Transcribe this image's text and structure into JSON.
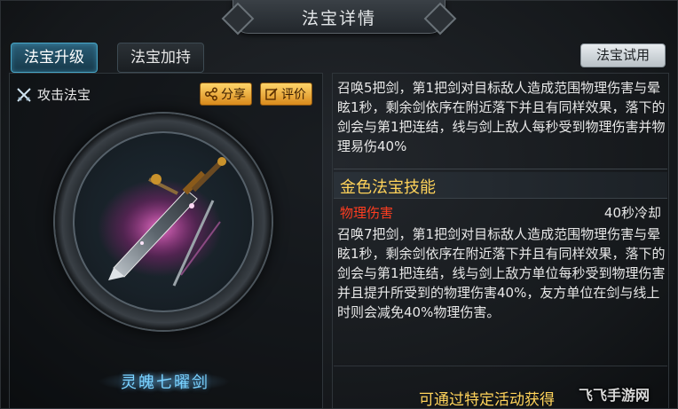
{
  "header": {
    "title": "法宝详情"
  },
  "tabs": [
    {
      "label": "法宝升级",
      "active": true
    },
    {
      "label": "法宝加持",
      "active": false
    }
  ],
  "try_button": "法宝试用",
  "artifact": {
    "type_label": "攻击法宝",
    "type_icon": "crossed-swords-icon",
    "share_label": "分享",
    "share_icon": "share-icon",
    "review_label": "评价",
    "review_icon": "edit-icon",
    "name": "灵魄七曜剑"
  },
  "description": "召唤5把剑，第1把剑对目标敌人造成范围物理伤害与晕眩1秒，剩余剑依序在附近落下并且有同样效果，落下的剑会与第1把连结，线与剑上敌人每秒受到物理伤害并物理易伤40%",
  "gold_skill": {
    "section_title": "金色法宝技能",
    "skill_name": "物理伤害",
    "cooldown": "40秒冷却",
    "description": "召唤7把剑，第1把剑对目标敌人造成范围物理伤害与晕眩1秒，剩余剑依序在附近落下并且有同样效果，落下的剑会与第1把连结，线与剑上敌方单位每秒受到物理伤害并且提升所受到的物理伤害40%，友方单位在剑与线上时则会减免40%物理伤害。"
  },
  "footer": {
    "obtain_text": "可通过特定活动获得"
  },
  "watermark": "飞飞手游网",
  "colors": {
    "accent_gold": "#ffd35a",
    "damage_red": "#ff3d20",
    "name_blue": "#7ad2ff",
    "tab_active": "#2a5f78"
  }
}
